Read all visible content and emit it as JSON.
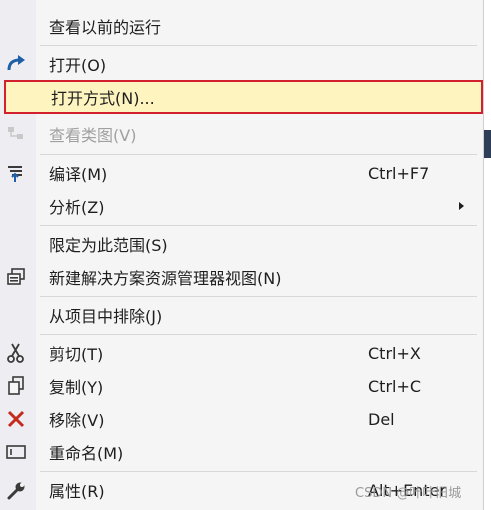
{
  "menu": {
    "items": [
      {
        "label": "查看以前的运行",
        "shortcut": "",
        "icon": "none"
      },
      {
        "label": "打开(O)",
        "shortcut": "",
        "icon": "open-arrow-icon"
      },
      {
        "label": "打开方式(N)...",
        "shortcut": "",
        "icon": "none"
      },
      {
        "label": "查看类图(V)",
        "shortcut": "",
        "icon": "class-diagram-icon"
      },
      {
        "label": "编译(M)",
        "shortcut": "Ctrl+F7",
        "icon": "compile-icon"
      },
      {
        "label": "分析(Z)",
        "shortcut": "",
        "icon": "none"
      },
      {
        "label": "限定为此范围(S)",
        "shortcut": "",
        "icon": "none"
      },
      {
        "label": "新建解决方案资源管理器视图(N)",
        "shortcut": "",
        "icon": "new-view-icon"
      },
      {
        "label": "从项目中排除(J)",
        "shortcut": "",
        "icon": "none"
      },
      {
        "label": "剪切(T)",
        "shortcut": "Ctrl+X",
        "icon": "scissors-icon"
      },
      {
        "label": "复制(Y)",
        "shortcut": "Ctrl+C",
        "icon": "copy-icon"
      },
      {
        "label": "移除(V)",
        "shortcut": "Del",
        "icon": "remove-x-icon"
      },
      {
        "label": "重命名(M)",
        "shortcut": "",
        "icon": "rename-icon"
      },
      {
        "label": "属性(R)",
        "shortcut": "Alt+Enter",
        "icon": "wrench-icon"
      }
    ]
  },
  "watermark": "CSDN @叶叶旧城",
  "colors": {
    "highlight_bg": "#fdf4bf",
    "highlight_border": "#d2202e",
    "icon_blue": "#1e5fa8",
    "remove_red": "#c42b1c"
  }
}
